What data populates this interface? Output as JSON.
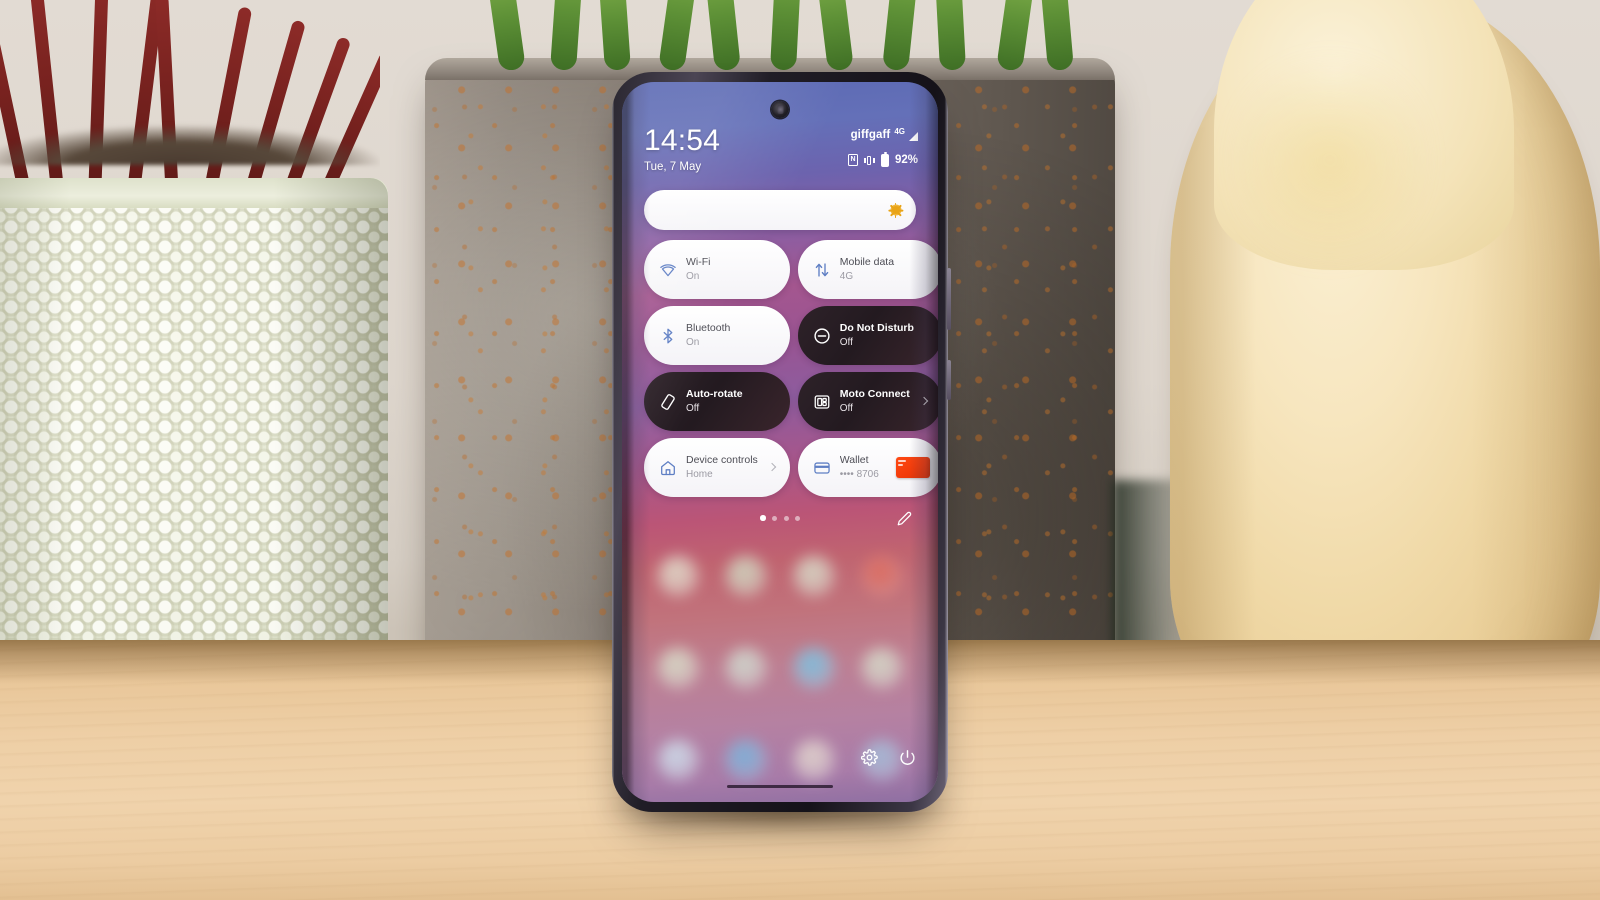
{
  "scene": {
    "description": "smartphone-on-wooden-table-with-plants",
    "objects": {
      "left_pot": "dimpled-cream-ceramic-planter",
      "centre_pot": "weathered-concrete-planter",
      "right_object": "butternut-squash",
      "surface": "light-wood-table"
    },
    "colors": {
      "wood": "#eecfa6",
      "wall": "#ded6cd",
      "left_pot": "#e6e9d6",
      "centre_pot": "#7d736a",
      "squash": "#f0d9a7"
    }
  },
  "phone": {
    "status_bar": {
      "clock": "14:54",
      "date": "Tue, 7 May",
      "carrier": "giffgaff",
      "network_type": "4G",
      "signal_icon": "signal-bars-icon",
      "nfc_icon": "nfc-icon",
      "nfc_glyph": "N",
      "vibrate_icon": "vibrate-icon",
      "battery_icon": "battery-icon",
      "battery_percent": "92%"
    },
    "brightness": {
      "label": "brightness-slider",
      "icon": "sun-icon",
      "level_percent": 96
    },
    "quick_settings": {
      "tiles": [
        {
          "title": "Wi-Fi",
          "subtitle": "On",
          "state": "on",
          "icon": "wifi-icon",
          "chevron": false,
          "thumb": false
        },
        {
          "title": "Mobile data",
          "subtitle": "4G",
          "state": "on",
          "icon": "mobile-data-icon",
          "chevron": false,
          "thumb": false
        },
        {
          "title": "Bluetooth",
          "subtitle": "On",
          "state": "on",
          "icon": "bluetooth-icon",
          "chevron": false,
          "thumb": false
        },
        {
          "title": "Do Not Disturb",
          "subtitle": "Off",
          "state": "off",
          "icon": "do-not-disturb-icon",
          "chevron": false,
          "thumb": false
        },
        {
          "title": "Auto-rotate",
          "subtitle": "Off",
          "state": "off",
          "icon": "auto-rotate-icon",
          "chevron": false,
          "thumb": false
        },
        {
          "title": "Moto Connect",
          "subtitle": "Off",
          "state": "off",
          "icon": "moto-connect-icon",
          "chevron": true,
          "thumb": false
        },
        {
          "title": "Device controls",
          "subtitle": "Home",
          "state": "on",
          "icon": "home-icon",
          "chevron": true,
          "thumb": false
        },
        {
          "title": "Wallet",
          "subtitle": "•••• 8706",
          "state": "on",
          "icon": "wallet-card-icon",
          "chevron": false,
          "thumb": true
        }
      ],
      "page_dots": {
        "count": 4,
        "active_index": 0
      },
      "edit_button": "edit-pencil-icon"
    },
    "bottom_actions": [
      {
        "name": "settings-button",
        "icon": "gear-icon"
      },
      {
        "name": "power-button",
        "icon": "power-icon"
      }
    ],
    "gesture_bar": "home-gesture-pill",
    "home_screen": {
      "blurred": true,
      "rows": [
        [
          "#e3e9d4",
          "#cfe2c6",
          "#d8e6cf",
          "#e06a5a"
        ],
        [
          "#d9e6cd",
          "#cfe2d4",
          "#6fc6e8",
          "#d6e3cd"
        ],
        [
          "#cfe7f2",
          "#6fb6e0",
          "#e6ddd0",
          "#9fc2dd"
        ]
      ]
    }
  }
}
